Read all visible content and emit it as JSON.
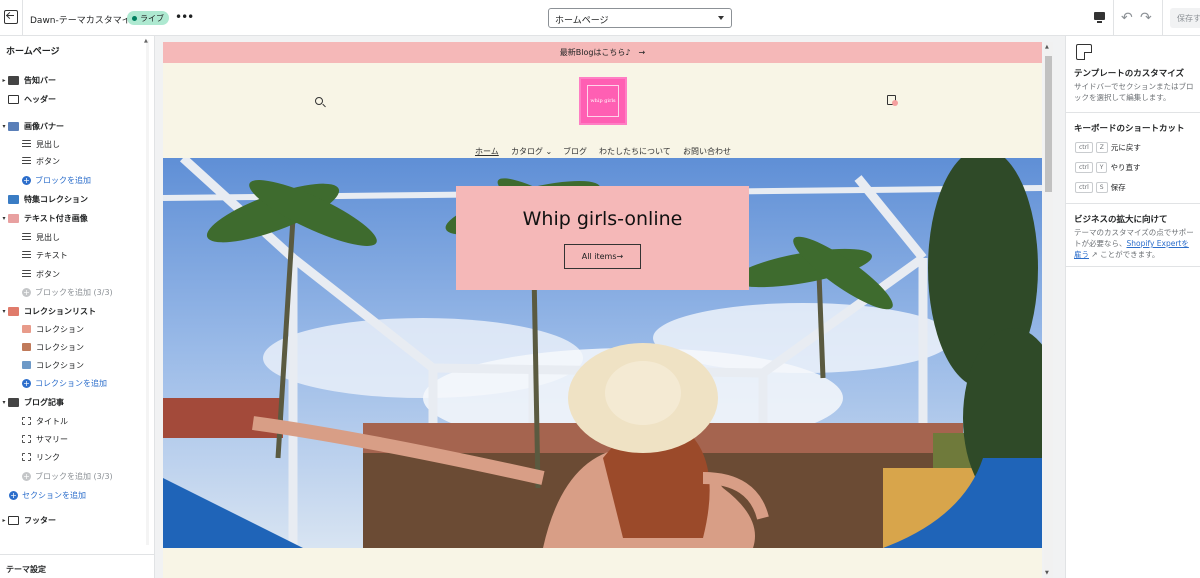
{
  "topbar": {
    "theme_name": "Dawn-テーマカスタマイズ",
    "live_badge": "ライブ",
    "page_select": "ホームページ",
    "save_label": "保存す",
    "colors": {
      "live_bg": "#aee9d1",
      "live_dot": "#007f5f"
    }
  },
  "sidebar": {
    "title": "ホームページ",
    "items": [
      {
        "label": "告知バー",
        "kind": "section",
        "icon": "announcement-bar-icon"
      },
      {
        "label": "ヘッダー",
        "kind": "section",
        "icon": "header-icon"
      },
      {
        "label": "画像バナー",
        "kind": "section",
        "icon": "image-banner-icon"
      },
      {
        "label": "見出し",
        "kind": "block",
        "icon": "text-lines-icon"
      },
      {
        "label": "ボタン",
        "kind": "block",
        "icon": "text-lines-icon"
      },
      {
        "label": "ブロックを追加",
        "kind": "add",
        "icon": "plus-circle-icon"
      },
      {
        "label": "特集コレクション",
        "kind": "section",
        "icon": "featured-collection-icon"
      },
      {
        "label": "テキスト付き画像",
        "kind": "section",
        "icon": "image-with-text-icon"
      },
      {
        "label": "見出し",
        "kind": "block",
        "icon": "text-lines-icon"
      },
      {
        "label": "テキスト",
        "kind": "block",
        "icon": "text-lines-icon"
      },
      {
        "label": "ボタン",
        "kind": "block",
        "icon": "text-lines-icon"
      },
      {
        "label": "ブロックを追加 (3/3)",
        "kind": "add-disabled",
        "icon": "plus-circle-icon"
      },
      {
        "label": "コレクションリスト",
        "kind": "section",
        "icon": "collection-list-icon"
      },
      {
        "label": "コレクション",
        "kind": "block",
        "icon": "collection-thumb-icon"
      },
      {
        "label": "コレクション",
        "kind": "block",
        "icon": "collection-thumb-icon"
      },
      {
        "label": "コレクション",
        "kind": "block",
        "icon": "collection-thumb-icon"
      },
      {
        "label": "コレクションを追加",
        "kind": "add",
        "icon": "plus-circle-icon"
      },
      {
        "label": "ブログ記事",
        "kind": "section",
        "icon": "blog-posts-icon"
      },
      {
        "label": "タイトル",
        "kind": "block",
        "icon": "corners-icon"
      },
      {
        "label": "サマリー",
        "kind": "block",
        "icon": "corners-icon"
      },
      {
        "label": "リンク",
        "kind": "block",
        "icon": "corners-icon"
      },
      {
        "label": "ブロックを追加 (3/3)",
        "kind": "add-disabled",
        "icon": "plus-circle-icon"
      },
      {
        "label": "セクションを追加",
        "kind": "add-section",
        "icon": "plus-circle-icon"
      },
      {
        "label": "フッター",
        "kind": "section",
        "icon": "footer-icon"
      }
    ],
    "footer_label": "テーマ設定"
  },
  "preview": {
    "announcement": "最新Blogはこちら♪　→",
    "logo_text": "whip girls",
    "nav": [
      "ホーム",
      "カタログ",
      "ブログ",
      "わたしたちについて",
      "お問い合わせ"
    ],
    "hero_title": "Whip girls-online",
    "hero_button": "All items→",
    "colors": {
      "announcement_bg": "#f5b8b8",
      "header_bg": "#f8f5e6",
      "hero_box": "#f5b8b8",
      "logo": "#ff5fb3"
    }
  },
  "right_panel": {
    "title": "テンプレートのカスタマイズ",
    "desc": "サイドバーでセクションまたはブロックを選択して編集します。",
    "shortcuts_title": "キーボードのショートカット",
    "shortcuts": [
      {
        "ctrl": "ctrl",
        "key": "Z",
        "label": "元に戻す"
      },
      {
        "ctrl": "ctrl",
        "key": "Y",
        "label": "やり直す"
      },
      {
        "ctrl": "ctrl",
        "key": "S",
        "label": "保存"
      }
    ],
    "growth_title": "ビジネスの拡大に向けて",
    "growth_desc_1": "テーマのカスタマイズの点でサポートが必要なら、",
    "growth_link": "Shopify Expertを雇う",
    "growth_desc_2": "ことができます。"
  }
}
